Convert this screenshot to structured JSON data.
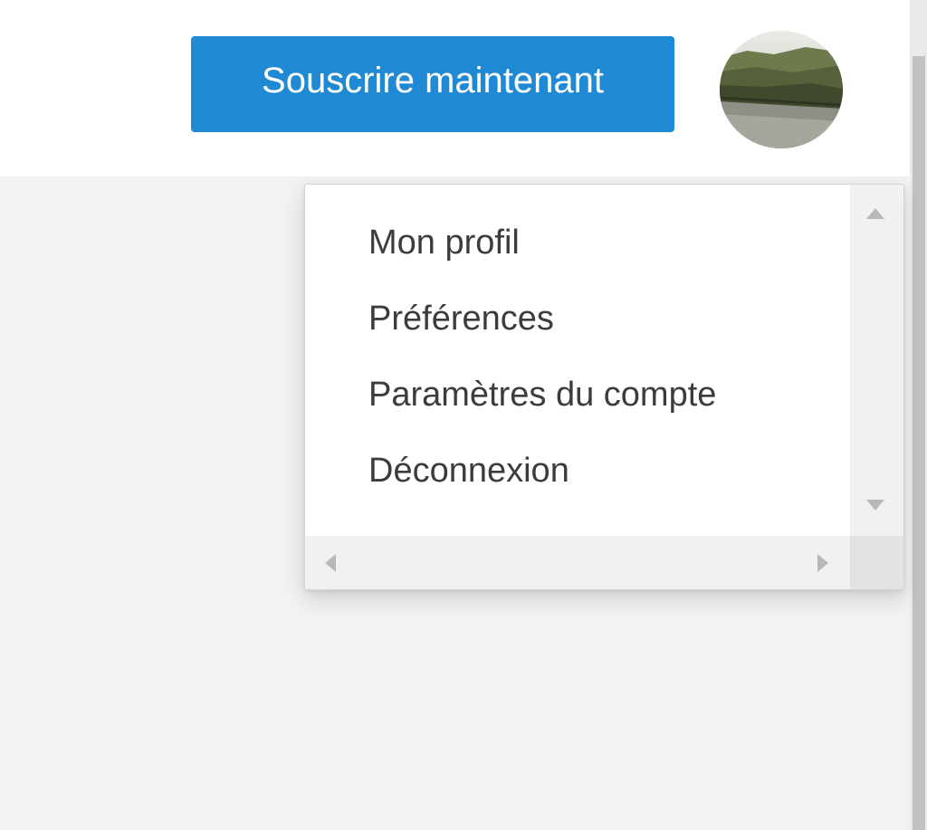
{
  "header": {
    "subscribe_label": "Souscrire maintenant",
    "avatar_icon": "user-avatar-photo"
  },
  "user_menu": {
    "items": [
      {
        "label": "Mon profil"
      },
      {
        "label": "Préférences"
      },
      {
        "label": "Paramètres du compte"
      },
      {
        "label": "Déconnexion"
      }
    ]
  },
  "colors": {
    "accent": "#1f8ad3",
    "menu_text": "#3c3c3c",
    "page_background": "#f2f2f2"
  }
}
